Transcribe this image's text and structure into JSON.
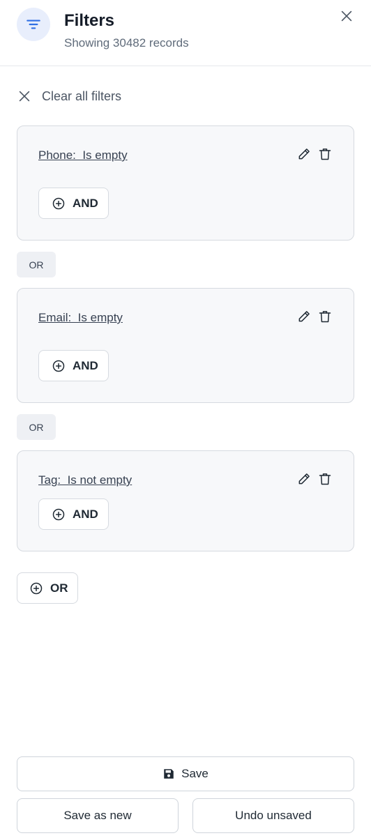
{
  "header": {
    "title": "Filters",
    "subtitle": "Showing 30482 records",
    "icon": "filter-icon",
    "close_icon": "close-icon",
    "accent_color": "#2f6fe4",
    "icon_bg_color": "#e8eefc"
  },
  "clear_all": {
    "label": "Clear all filters",
    "icon": "close-icon"
  },
  "groups": [
    {
      "condition": "Phone:  Is empty",
      "and_label": "AND",
      "edit_icon": "pencil-icon",
      "delete_icon": "trash-icon"
    },
    {
      "condition": "Email:  Is empty",
      "and_label": "AND",
      "edit_icon": "pencil-icon",
      "delete_icon": "trash-icon"
    },
    {
      "condition": "Tag:  Is not empty",
      "and_label": "AND",
      "edit_icon": "pencil-icon",
      "delete_icon": "trash-icon"
    }
  ],
  "or_separator": "OR",
  "add_or_label": "OR",
  "footer": {
    "save_label": "Save",
    "save_icon": "floppy-disk-icon",
    "save_as_new_label": "Save as new",
    "undo_unsaved_label": "Undo unsaved"
  }
}
